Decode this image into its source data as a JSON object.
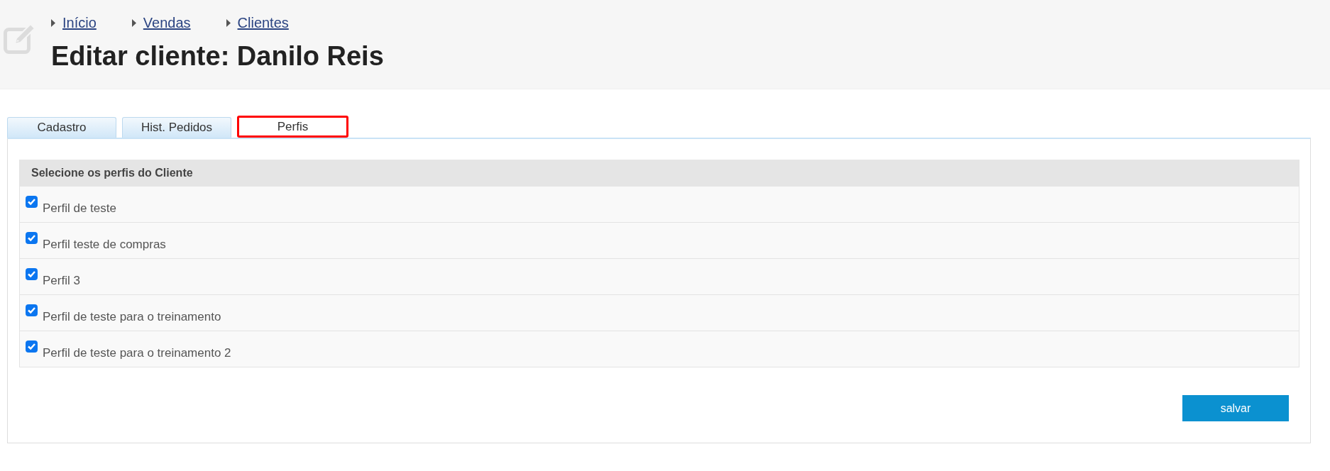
{
  "header": {
    "breadcrumbs": [
      {
        "label": "Início"
      },
      {
        "label": "Vendas"
      },
      {
        "label": "Clientes"
      }
    ],
    "title": "Editar cliente: Danilo Reis"
  },
  "tabs": [
    {
      "label": "Cadastro",
      "selected": false
    },
    {
      "label": "Hist. Pedidos",
      "selected": false
    },
    {
      "label": "Perfis",
      "selected": true
    }
  ],
  "profiles": {
    "heading": "Selecione os perfis do Cliente",
    "items": [
      {
        "label": "Perfil de teste",
        "checked": true
      },
      {
        "label": "Perfil teste de compras",
        "checked": true
      },
      {
        "label": "Perfil 3",
        "checked": true
      },
      {
        "label": "Perfil de teste para o treinamento",
        "checked": true
      },
      {
        "label": "Perfil de teste para o treinamento 2",
        "checked": true
      }
    ]
  },
  "buttons": [
    {
      "label": "salvar"
    }
  ]
}
